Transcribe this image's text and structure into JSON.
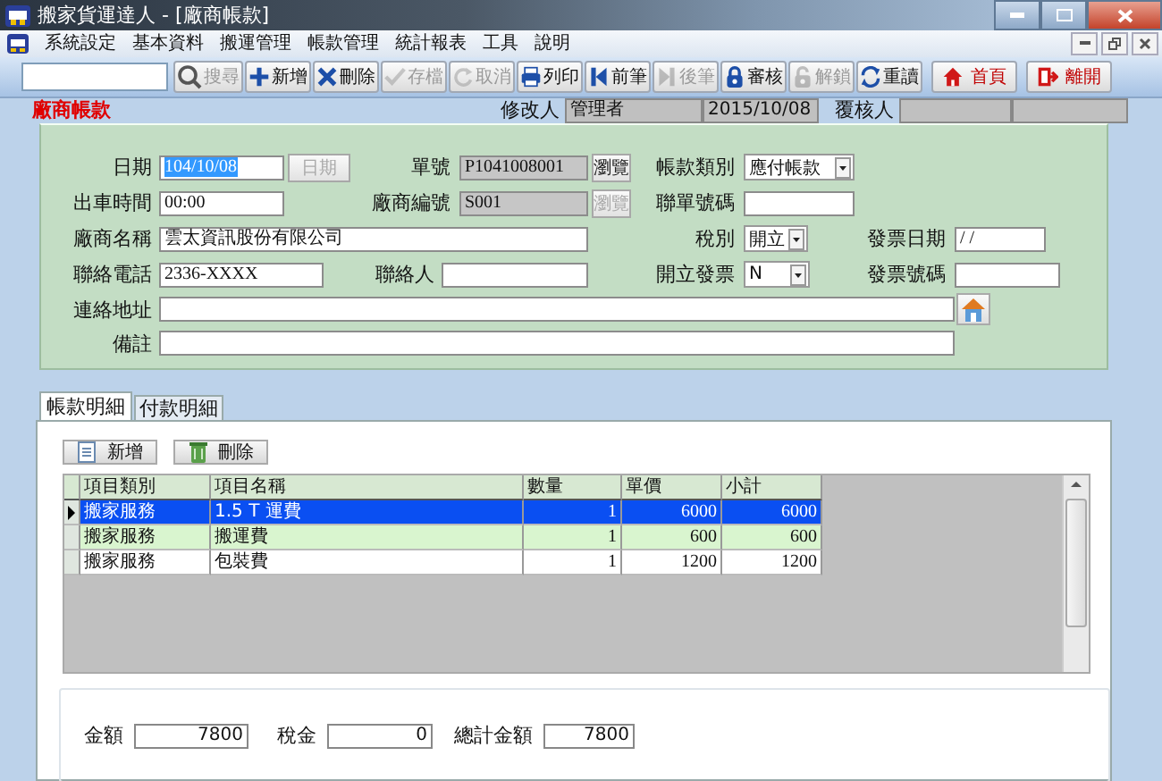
{
  "window": {
    "title": "搬家貨運達人 - [廠商帳款]"
  },
  "menu": [
    {
      "label": "系統設定"
    },
    {
      "label": "基本資料"
    },
    {
      "label": "搬運管理"
    },
    {
      "label": "帳款管理"
    },
    {
      "label": "統計報表"
    },
    {
      "label": "工具"
    },
    {
      "label": "說明"
    }
  ],
  "toolbar": {
    "search_button": {
      "label": "搜尋",
      "disabled": true
    },
    "buttons": [
      {
        "label": "新增",
        "disabled": false,
        "kind": "plain"
      },
      {
        "label": "刪除",
        "disabled": false,
        "kind": "plain"
      },
      {
        "label": "存檔",
        "disabled": true,
        "kind": "plain"
      },
      {
        "label": "取消",
        "disabled": true,
        "kind": "plain"
      },
      {
        "label": "列印",
        "disabled": false,
        "kind": "plain"
      },
      {
        "label": "前筆",
        "disabled": false,
        "kind": "plain"
      },
      {
        "label": "後筆",
        "disabled": true,
        "kind": "plain"
      },
      {
        "label": "審核",
        "disabled": false,
        "kind": "plain"
      },
      {
        "label": "解鎖",
        "disabled": true,
        "kind": "plain"
      },
      {
        "label": "重讀",
        "disabled": false,
        "kind": "plain"
      },
      {
        "label": "首頁",
        "disabled": false,
        "kind": "nav"
      },
      {
        "label": "離開",
        "disabled": false,
        "kind": "nav"
      }
    ]
  },
  "header": {
    "title": "廠商帳款",
    "modifier_label": "修改人",
    "modifier": "管理者",
    "modified_date": "2015/10/08",
    "reviewer_label": "覆核人"
  },
  "form": {
    "rows": [
      {
        "fields": [
          {
            "kind": "label",
            "text": "日期"
          },
          {
            "kind": "input",
            "value": "104/10/08",
            "text_selected": true
          },
          {
            "kind": "button",
            "text": "日期",
            "disabled": true
          },
          {
            "kind": "label",
            "text": "單號"
          },
          {
            "kind": "input",
            "value": "P1041008001",
            "readonly": true
          },
          {
            "kind": "button",
            "text": "瀏覽",
            "disabled": false
          },
          {
            "kind": "label",
            "text": "帳款類別"
          },
          {
            "kind": "select",
            "value": "應付帳款"
          }
        ]
      },
      {
        "fields": [
          {
            "kind": "label",
            "text": "出車時間"
          },
          {
            "kind": "input",
            "value": "00:00"
          },
          {
            "kind": "label",
            "text": "廠商編號"
          },
          {
            "kind": "input",
            "value": "S001",
            "readonly": true
          },
          {
            "kind": "button",
            "text": "瀏覽",
            "disabled": true
          },
          {
            "kind": "label",
            "text": "聯單號碼"
          },
          {
            "kind": "input"
          }
        ]
      },
      {
        "fields": [
          {
            "kind": "label",
            "text": "廠商名稱"
          },
          {
            "kind": "input",
            "value": "雲太資訊股份有限公司"
          },
          {
            "kind": "label",
            "text": "稅別"
          },
          {
            "kind": "select",
            "value": "開立"
          },
          {
            "kind": "label",
            "text": "發票日期"
          },
          {
            "kind": "input",
            "value": " / /"
          }
        ]
      },
      {
        "fields": [
          {
            "kind": "label",
            "text": "聯絡電話"
          },
          {
            "kind": "input",
            "value": "2336-XXXX"
          },
          {
            "kind": "label",
            "text": "聯絡人"
          },
          {
            "kind": "input"
          },
          {
            "kind": "label",
            "text": "開立發票"
          },
          {
            "kind": "select",
            "value": "N"
          },
          {
            "kind": "label",
            "text": "發票號碼"
          },
          {
            "kind": "input"
          }
        ]
      },
      {
        "fields": [
          {
            "kind": "label",
            "text": "連絡地址"
          },
          {
            "kind": "input"
          },
          {
            "kind": "icon_button"
          }
        ]
      },
      {
        "fields": [
          {
            "kind": "label",
            "text": "備註"
          },
          {
            "kind": "input"
          }
        ]
      }
    ]
  },
  "tabs": [
    {
      "label": "帳款明細",
      "selected": true
    },
    {
      "label": "付款明細",
      "selected": false
    }
  ],
  "detail_buttons": [
    {
      "label": "新增"
    },
    {
      "label": "刪除"
    }
  ],
  "table": {
    "columns": [
      "項目類別",
      "項目名稱",
      "數量",
      "單價",
      "小計"
    ],
    "rows": [
      {
        "cells": [
          "搬家服務",
          "1.5 T 運費",
          "1",
          "6000",
          "6000"
        ],
        "selected": true
      },
      {
        "cells": [
          "搬家服務",
          "搬運費",
          "1",
          "600",
          "600"
        ],
        "selected": false
      },
      {
        "cells": [
          "搬家服務",
          "包裝費",
          "1",
          "1200",
          "1200"
        ],
        "selected": false
      }
    ]
  },
  "totals": [
    {
      "label": "金額",
      "value": "7800"
    },
    {
      "label": "稅金",
      "value": "0"
    },
    {
      "label": "總計金額",
      "value": "7800"
    }
  ]
}
